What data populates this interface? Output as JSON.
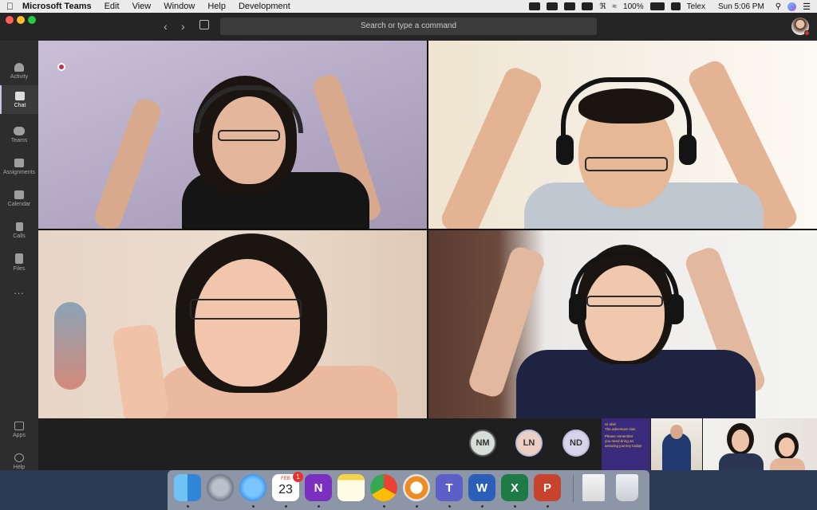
{
  "menubar": {
    "app_name": "Microsoft Teams",
    "menus": [
      "Edit",
      "View",
      "Window",
      "Help",
      "Development"
    ],
    "battery": "100%",
    "input_source": "Telex",
    "clock": "Sun 5:06 PM"
  },
  "titlebar": {
    "search_placeholder": "Search or type a command"
  },
  "left_rail": {
    "items": [
      {
        "label": "Activity",
        "icon": "bell-icon",
        "active": false
      },
      {
        "label": "Chat",
        "icon": "chat-icon",
        "active": true
      },
      {
        "label": "Teams",
        "icon": "teams-icon",
        "active": false
      },
      {
        "label": "Assignments",
        "icon": "assignments-icon",
        "active": false
      },
      {
        "label": "Calendar",
        "icon": "calendar-icon",
        "active": false
      },
      {
        "label": "Calls",
        "icon": "phone-icon",
        "active": false
      },
      {
        "label": "Files",
        "icon": "file-icon",
        "active": false
      }
    ],
    "more": "...",
    "bottom_items": [
      {
        "label": "Apps",
        "icon": "apps-icon"
      },
      {
        "label": "Help",
        "icon": "help-icon"
      }
    ]
  },
  "participants_strip": {
    "avatars": [
      {
        "initials": "NM"
      },
      {
        "initials": "LN"
      },
      {
        "initials": "ND"
      }
    ],
    "share_thumbnail_lines": [
      "Hi nhé!",
      "The adventure clan",
      "Please remember",
      "you need bring an",
      "amazing journey today!"
    ]
  },
  "dock": {
    "calendar_month": "FEB",
    "calendar_day": "23",
    "calendar_badge": "1"
  },
  "colors": {
    "accent": "#c5c5e6",
    "recording": "#c4314b",
    "window_bg": "#1f1f1f",
    "rail_bg": "#2d2d2d"
  }
}
